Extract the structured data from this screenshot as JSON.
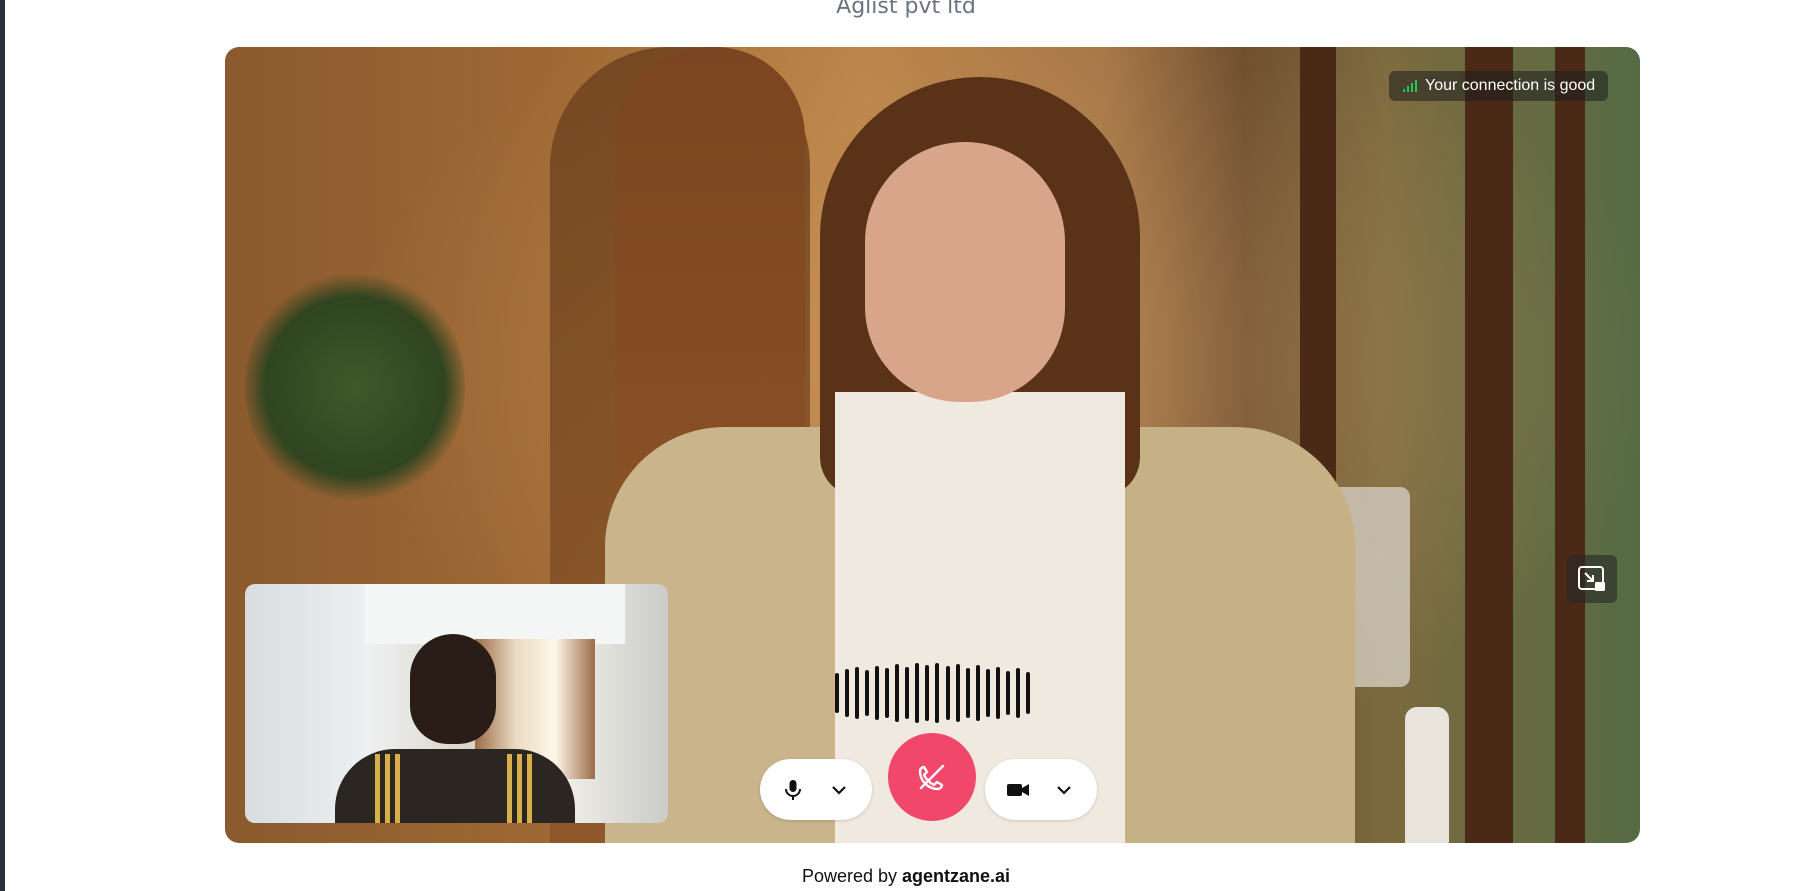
{
  "header": {
    "company_name": "Aglist pvt ltd"
  },
  "call": {
    "connection_status": "Your connection is good",
    "icons": {
      "signal": "signal-bars-icon",
      "pip": "picture-in-picture-icon",
      "mic": "microphone-icon",
      "mic_menu": "chevron-down-icon",
      "end_call": "phone-off-icon",
      "camera": "video-camera-icon",
      "camera_menu": "chevron-down-icon"
    }
  },
  "footer": {
    "powered_prefix": "Powered by",
    "brand": "agentzane.ai"
  },
  "colors": {
    "end_call": "#f0476a",
    "signal": "#22c55e"
  }
}
